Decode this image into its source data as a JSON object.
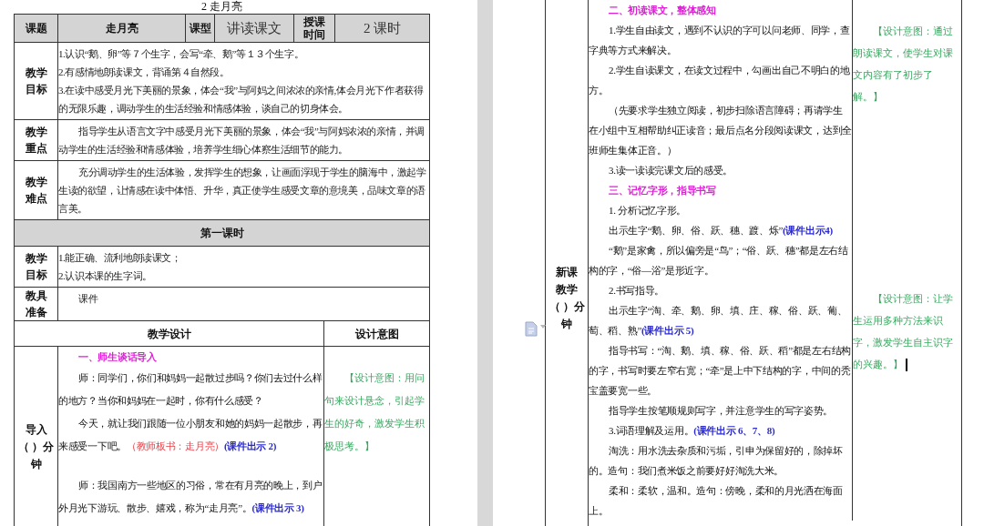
{
  "left_page": {
    "title": "2 走月亮",
    "header_cells": [
      "课题",
      "走月亮",
      "课型",
      "讲读课文",
      "授课时间",
      "2 课时"
    ],
    "rows": [
      {
        "label": "教学目标",
        "paragraphs": [
          {
            "text": "1.认识“鹅、卵”等７个生字，会写“牵、鹅”等１３个生字。"
          },
          {
            "text": "2.有感情地朗读课文，背诵第４自然段。"
          },
          {
            "text": "3.在读中感受月光下美丽的景象，体会“我”与阿妈之间浓浓的亲情,体会月光下作者获得的无限乐趣，调动学生的生活经验和情感体验，谈自己的切身体会。"
          }
        ]
      },
      {
        "label": "教学重点",
        "paragraphs": [
          {
            "text": "指导学生从语言文字中感受月光下美丽的景象，体会“我”与阿妈浓浓的亲情，并调动学生的生活经验和情感体验，培养学生细心体察生活细节的能力。"
          }
        ]
      },
      {
        "label": "教学难点",
        "paragraphs": [
          {
            "text": "充分调动学生的生活体验，发挥学生的想象，让画面浮现于学生的脑海中，激起学生读的欲望，让情感在读中体悟、升华，真正使学生感受文章的意境美，品味文章的语言美。"
          }
        ]
      }
    ],
    "section_title": "第一课时",
    "rows2": [
      {
        "label": "教学目标",
        "paragraphs": [
          {
            "text": "1.能正确、流利地朗读课文；"
          },
          {
            "text": "2.认识本课的生字词。"
          }
        ]
      },
      {
        "label": "教具准备",
        "paragraphs": [
          {
            "text": "课件"
          }
        ]
      }
    ],
    "design_header": [
      "教学设计",
      "设计意图"
    ],
    "stage": {
      "label_lines": [
        "导入",
        "（ ）分",
        "钟"
      ],
      "sections": [
        {
          "heading": "一、师生谈话导入",
          "paragraphs": [
            {
              "text": "师：同学们，你们和妈妈一起散过步吗？你们去过什么样的地方？当你和妈妈在一起时，你有什么感受？"
            },
            {
              "text": "今天，就让我们跟随一位小朋友和她的妈妈一起散步，再来感受一下吧。",
              "board": "（教师板书：走月亮）",
              "slide": "(课件出示 2)"
            },
            {
              "text": "师：我国南方一些地区的习俗，常在有月亮的晚上，到户外月光下游玩、散步、嬉戏，称为“走月亮”。",
              "slide": "(课件出示 3)"
            }
          ],
          "note": "【设计意图：用问句来设计悬念，引起学生的好奇，激发学生积极思考。】"
        }
      ]
    }
  },
  "right_page": {
    "stage": {
      "label_lines": [
        "新课",
        "教学",
        "（ ）分",
        "钟"
      ],
      "sections": [
        {
          "heading": "二、初读课文，整体感知",
          "paragraphs": [
            {
              "text": "1.学生自由读文，遇到不认识的字可以问老师、同学，查字典等方式来解决。"
            },
            {
              "text": "2.学生自读课文，在读文过程中，勾画出自己不明白的地方。"
            },
            {
              "text": "（先要求学生独立阅读，初步扫除语言障碍；再请学生在小组中互相帮助纠正读音；最后点名分段阅读课文，达到全班师生集体正音。）"
            },
            {
              "text": "3.读一读读完课文后的感受。"
            }
          ],
          "note": "【设计意图：通过朗读课文，使学生对课文内容有了初步了解。】"
        },
        {
          "heading": "三、记忆字形，指导书写",
          "paragraphs": [
            {
              "text": "1. 分析记忆字形。"
            },
            {
              "text": "出示生字“鹅、卵、俗、跃、穗、踱、烁”",
              "slide": "(课件出示4)"
            },
            {
              "text": "“鹅”是家禽，所以偏旁是“鸟”；“俗、跃、穗”都是左右结构的字，“俗—浴”是形近字。"
            },
            {
              "text": "2.书写指导。"
            },
            {
              "text": "出示生字“淘、牵、鹅、卵、填、庄、稼、俗、跃、葡、萄、稻、熟”",
              "slide": "(课件出示 5)"
            },
            {
              "text": "指导书写：“淘、鹅、填、稼、俗、跃、稻”都是左右结构的字，书写时要左窄右宽；“牵”是上中下结构的字，中间的秃宝盖要宽一些。"
            },
            {
              "text": "指导学生按笔顺规则写字，并注意学生的写字姿势。"
            },
            {
              "text": "3.词语理解及运用。",
              "slide": "(课件出示 6、7、8)"
            },
            {
              "text": "淘洗：用水洗去杂质和污垢，引申为保留好的，除掉坏的。造句：我们煮米饭之前要好好淘洗大米。"
            },
            {
              "text": "柔和：柔软，温和。造句：傍晚，柔和的月光洒在海面上。"
            }
          ],
          "note": "【设计意图：让学生运用多种方法来识字，激发学生自主识字的兴趣。】",
          "cursor": true
        }
      ]
    }
  }
}
